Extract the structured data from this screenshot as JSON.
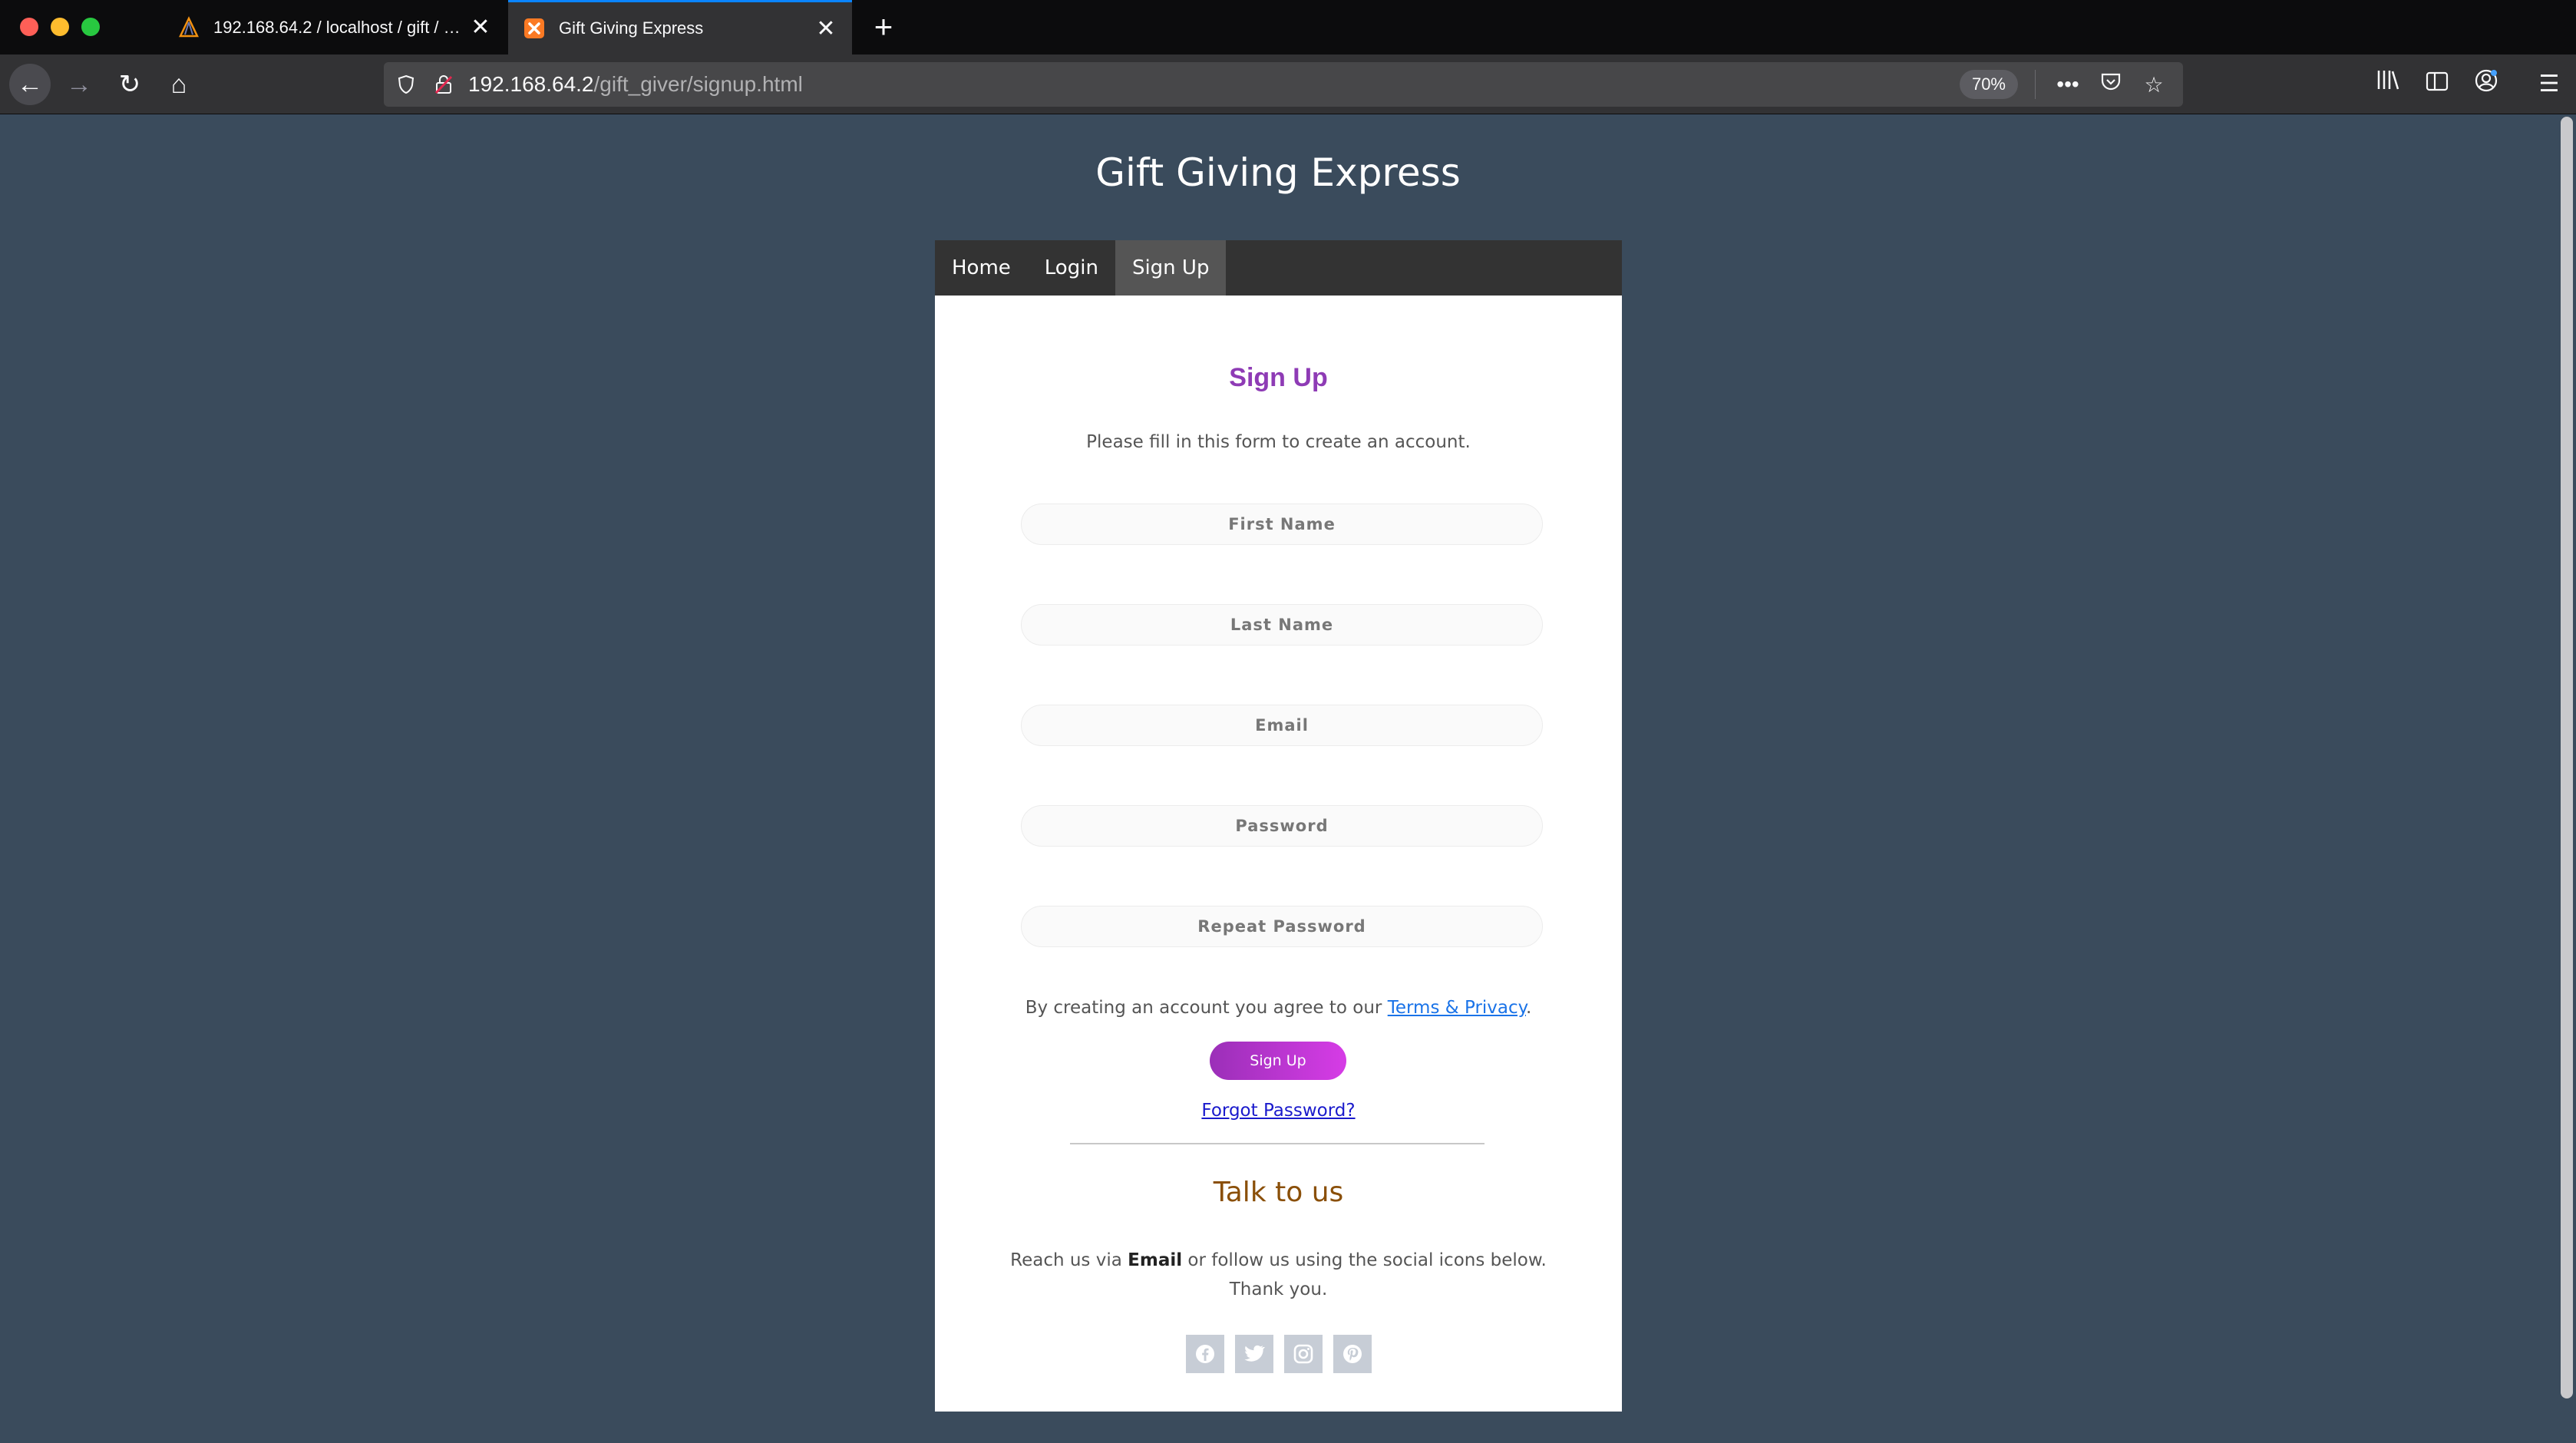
{
  "browser": {
    "tabs": [
      {
        "title": "192.168.64.2 / localhost / gift / …",
        "icon": "phpmyadmin-sail-icon",
        "active": false
      },
      {
        "title": "Gift Giving Express",
        "icon": "xampp-icon",
        "active": true
      }
    ],
    "url_host": "192.168.64.2",
    "url_path": "/gift_giver/signup.html",
    "zoom": "70%"
  },
  "site": {
    "title": "Gift Giving Express",
    "nav": [
      "Home",
      "Login",
      "Sign Up"
    ],
    "active_nav": "Sign Up"
  },
  "form": {
    "heading": "Sign Up",
    "subtitle": "Please fill in this form to create an account.",
    "fields": {
      "first_name": "First Name",
      "last_name": "Last Name",
      "email": "Email",
      "password": "Password",
      "repeat_password": "Repeat Password"
    },
    "terms_prefix": "By creating an account you agree to our ",
    "terms_link": "Terms & Privacy",
    "terms_suffix": ".",
    "submit_label": "Sign Up",
    "forgot_label": "Forgot Password?"
  },
  "contact": {
    "heading": "Talk to us",
    "text_prefix": "Reach us via ",
    "email_label": "Email",
    "text_suffix": " or follow us using the social icons below.",
    "thanks": "Thank you.",
    "socials": [
      "facebook-icon",
      "twitter-icon",
      "instagram-icon",
      "pinterest-icon"
    ]
  },
  "colors": {
    "page_bg": "#3a4b5c",
    "heading_purple": "#8e3bb5",
    "talk_brown": "#8a4f08",
    "button_gradient_start": "#9b2fb8",
    "button_gradient_end": "#d63ce6"
  }
}
